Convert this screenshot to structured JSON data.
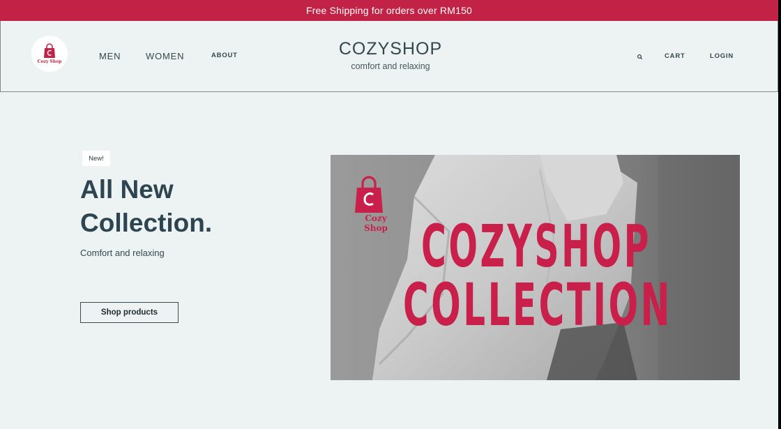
{
  "promo": {
    "text": "Free Shipping for orders over RM150"
  },
  "header": {
    "logo_text": "Cozy Shop",
    "nav": {
      "men": "MEN",
      "women": "WOMEN",
      "about": "ABOUT"
    },
    "brand": {
      "title": "COZYSHOP",
      "tagline": "comfort and relaxing"
    },
    "right": {
      "search_icon": "search-icon",
      "cart": "CART",
      "login": "LOGIN"
    }
  },
  "hero": {
    "badge": "New!",
    "title": "All New Collection.",
    "subtitle": "Comfort and relaxing",
    "button": "Shop products"
  },
  "banner": {
    "logo_text": "Cozy Shop",
    "line1": "COZYSHOP",
    "line2": "COLLECTION"
  },
  "colors": {
    "accent": "#c12246",
    "background": "#edf3f3",
    "text": "#2e4450"
  }
}
